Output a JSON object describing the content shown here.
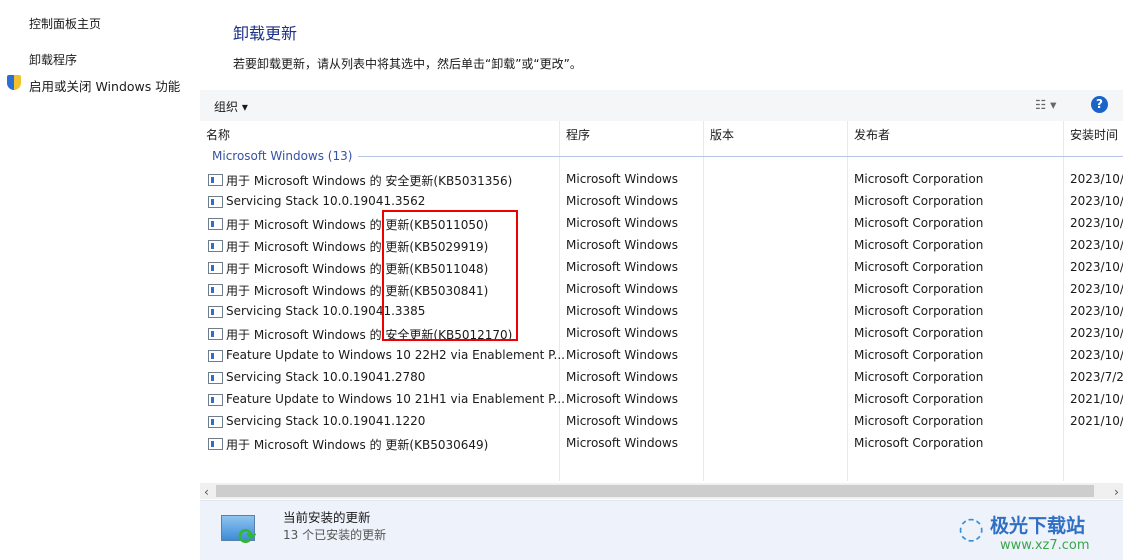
{
  "sidebar": {
    "home": "控制面板主页",
    "uninstall": "卸载程序",
    "features": "启用或关闭 Windows 功能"
  },
  "header": {
    "title": "卸载更新",
    "description": "若要卸载更新，请从列表中将其选中，然后单击“卸载”或“更改”。"
  },
  "toolbar": {
    "organize": "组织 ▾",
    "view": "☷ ▾",
    "help": "?"
  },
  "columns": [
    "名称",
    "程序",
    "版本",
    "发布者",
    "安装时间"
  ],
  "group": "Microsoft Windows (13)",
  "rows": [
    {
      "name": "用于 Microsoft Windows 的 安全更新(KB5031356)",
      "program": "Microsoft Windows",
      "publisher": "Microsoft Corporation",
      "date": "2023/10/"
    },
    {
      "name": "Servicing Stack 10.0.19041.3562",
      "program": "Microsoft Windows",
      "publisher": "Microsoft Corporation",
      "date": "2023/10/"
    },
    {
      "name": "用于 Microsoft Windows 的 更新(KB5011050)",
      "program": "Microsoft Windows",
      "publisher": "Microsoft Corporation",
      "date": "2023/10/"
    },
    {
      "name": "用于 Microsoft Windows 的 更新(KB5029919)",
      "program": "Microsoft Windows",
      "publisher": "Microsoft Corporation",
      "date": "2023/10/"
    },
    {
      "name": "用于 Microsoft Windows 的 更新(KB5011048)",
      "program": "Microsoft Windows",
      "publisher": "Microsoft Corporation",
      "date": "2023/10/"
    },
    {
      "name": "用于 Microsoft Windows 的 更新(KB5030841)",
      "program": "Microsoft Windows",
      "publisher": "Microsoft Corporation",
      "date": "2023/10/"
    },
    {
      "name": "Servicing Stack 10.0.19041.3385",
      "program": "Microsoft Windows",
      "publisher": "Microsoft Corporation",
      "date": "2023/10/"
    },
    {
      "name": "用于 Microsoft Windows 的 安全更新(KB5012170)",
      "program": "Microsoft Windows",
      "publisher": "Microsoft Corporation",
      "date": "2023/10/"
    },
    {
      "name": "Feature Update to Windows 10 22H2 via Enablement P...",
      "program": "Microsoft Windows",
      "publisher": "Microsoft Corporation",
      "date": "2023/10/"
    },
    {
      "name": "Servicing Stack 10.0.19041.2780",
      "program": "Microsoft Windows",
      "publisher": "Microsoft Corporation",
      "date": "2023/7/2"
    },
    {
      "name": "Feature Update to Windows 10 21H1 via Enablement P...",
      "program": "Microsoft Windows",
      "publisher": "Microsoft Corporation",
      "date": "2021/10/"
    },
    {
      "name": "Servicing Stack 10.0.19041.1220",
      "program": "Microsoft Windows",
      "publisher": "Microsoft Corporation",
      "date": "2021/10/"
    },
    {
      "name": "用于 Microsoft Windows 的 更新(KB5030649)",
      "program": "Microsoft Windows",
      "publisher": "Microsoft Corporation",
      "date": ""
    }
  ],
  "status": {
    "title": "当前安装的更新",
    "count": "13 个已安装的更新"
  },
  "watermark": {
    "name": "极光下载站",
    "url": "www.xz7.com"
  }
}
